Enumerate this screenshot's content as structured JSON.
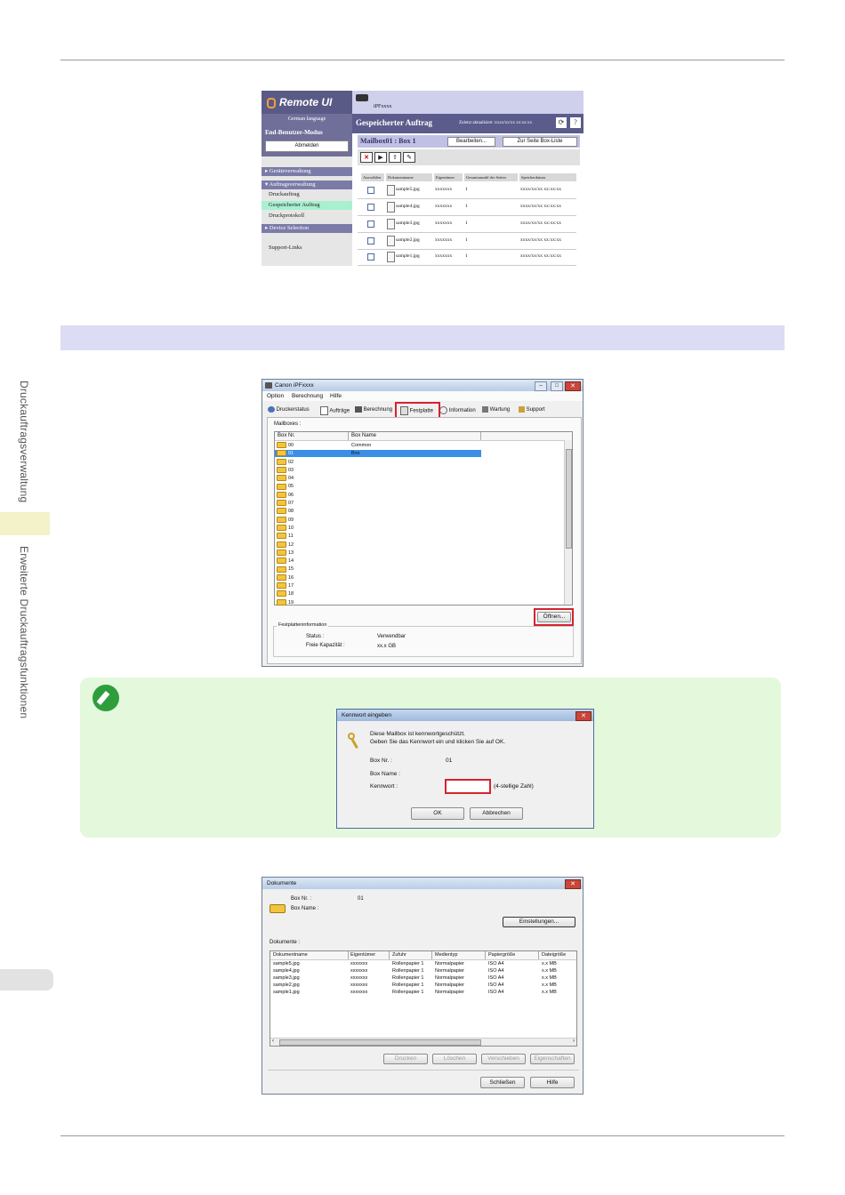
{
  "side": {
    "label_top": "Druckauftragsverwaltung",
    "label_bottom": "Erweiterte Druckauftragsfunktionen"
  },
  "remote_ui": {
    "logo": "Remote UI",
    "language": "German language",
    "mode": "End-Benutzer-Modus",
    "logout": "Abmelden",
    "printer": "iPFxxxx",
    "page_title": "Gespeicherter Auftrag",
    "last_update": "Zuletzt aktualisiert :xxxx/xx/xx xx:xx:xx",
    "nav": {
      "device": "Geräteverwaltung",
      "jobs": "Auftragsverwaltung",
      "print_job": "Druckauftrag",
      "stored_job": "Gespeicherter Auftrag",
      "print_log": "Druckprotokoll",
      "device_selection": "Device Selection",
      "support": "Support-Links"
    },
    "mailbox_title": "Mailbox01 : Box 1",
    "edit_button": "Bearbeiten...",
    "box_list_button": "Zur Seite Box-Liste",
    "columns": [
      "Auswählen",
      "Dokumentname",
      "Eigentümer",
      "Gesamtanzahl der Seiten",
      "Speicherdatum"
    ],
    "rows": [
      {
        "name": "sample5.jpg",
        "owner": "xxxxxxx",
        "pages": "1",
        "date": "xxxx/xx/xx xx:xx:xx"
      },
      {
        "name": "sample4.jpg",
        "owner": "xxxxxxx",
        "pages": "1",
        "date": "xxxx/xx/xx xx:xx:xx"
      },
      {
        "name": "sample3.jpg",
        "owner": "xxxxxxx",
        "pages": "1",
        "date": "xxxx/xx/xx xx:xx:xx"
      },
      {
        "name": "sample2.jpg",
        "owner": "xxxxxxx",
        "pages": "1",
        "date": "xxxx/xx/xx xx:xx:xx"
      },
      {
        "name": "sample1.jpg",
        "owner": "xxxxxxx",
        "pages": "1",
        "date": "xxxx/xx/xx xx:xx:xx"
      }
    ]
  },
  "canon": {
    "title": "Canon iPFxxxx",
    "menu": [
      "Option",
      "Berechnung",
      "Hilfe"
    ],
    "tabs": [
      "Druckerstatus",
      "Aufträge",
      "Berechnung",
      "Festplatte",
      "Information",
      "Wartung",
      "Support"
    ],
    "mailboxes_label": "Mailboxes :",
    "col_box_nr": "Box Nr.",
    "col_box_name": "Box Name",
    "boxes": [
      "00",
      "01",
      "02",
      "03",
      "04",
      "05",
      "06",
      "07",
      "08",
      "09",
      "10",
      "11",
      "12",
      "13",
      "14",
      "15",
      "16",
      "17",
      "18",
      "19"
    ],
    "common_box": "Common Box",
    "open_button": "Öffnen...",
    "hdd_info_label": "Festplatteninformation",
    "status_label": "Status :",
    "status_value": "Verwendbar",
    "free_label": "Freie Kapazität :",
    "free_value": "xx.x GB"
  },
  "password_dialog": {
    "title": "Kennwort eingeben",
    "message_line1": "Diese Mailbox ist kennwortgeschützt.",
    "message_line2": "Geben Sie das Kennwort ein und klicken Sie auf OK.",
    "box_nr_label": "Box Nr. :",
    "box_nr_value": "01",
    "box_name_label": "Box Name :",
    "password_label": "Kennwort :",
    "password_hint": "(4-stellige Zahl)",
    "ok": "OK",
    "cancel": "Abbrechen"
  },
  "documents_dialog": {
    "title": "Dokumente",
    "box_nr_label": "Box Nr. :",
    "box_nr_value": "01",
    "box_name_label": "Box Name :",
    "settings_button": "Einstellungen...",
    "documents_label": "Dokumente :",
    "columns": [
      "Dokumentname",
      "Eigentümer",
      "Zufuhr",
      "Medientyp",
      "Papiergröße",
      "Dateigröße"
    ],
    "rows": [
      [
        "sample5.jpg",
        "xxxxxxx",
        "Rollenpapier 1",
        "Normalpapier",
        "ISO A4",
        "x.x MB"
      ],
      [
        "sample4.jpg",
        "xxxxxxx",
        "Rollenpapier 1",
        "Normalpapier",
        "ISO A4",
        "x.x MB"
      ],
      [
        "sample3.jpg",
        "xxxxxxx",
        "Rollenpapier 1",
        "Normalpapier",
        "ISO A4",
        "x.x MB"
      ],
      [
        "sample2.jpg",
        "xxxxxxx",
        "Rollenpapier 1",
        "Normalpapier",
        "ISO A4",
        "x.x MB"
      ],
      [
        "sample1.jpg",
        "xxxxxxx",
        "Rollenpapier 1",
        "Normalpapier",
        "ISO A4",
        "x.x MB"
      ]
    ],
    "print_button": "Drucken",
    "delete_button": "Löschen",
    "move_button": "Verschieben",
    "properties_button": "Eigenschaften",
    "close_button": "Schließen",
    "help_button": "Hilfe"
  }
}
